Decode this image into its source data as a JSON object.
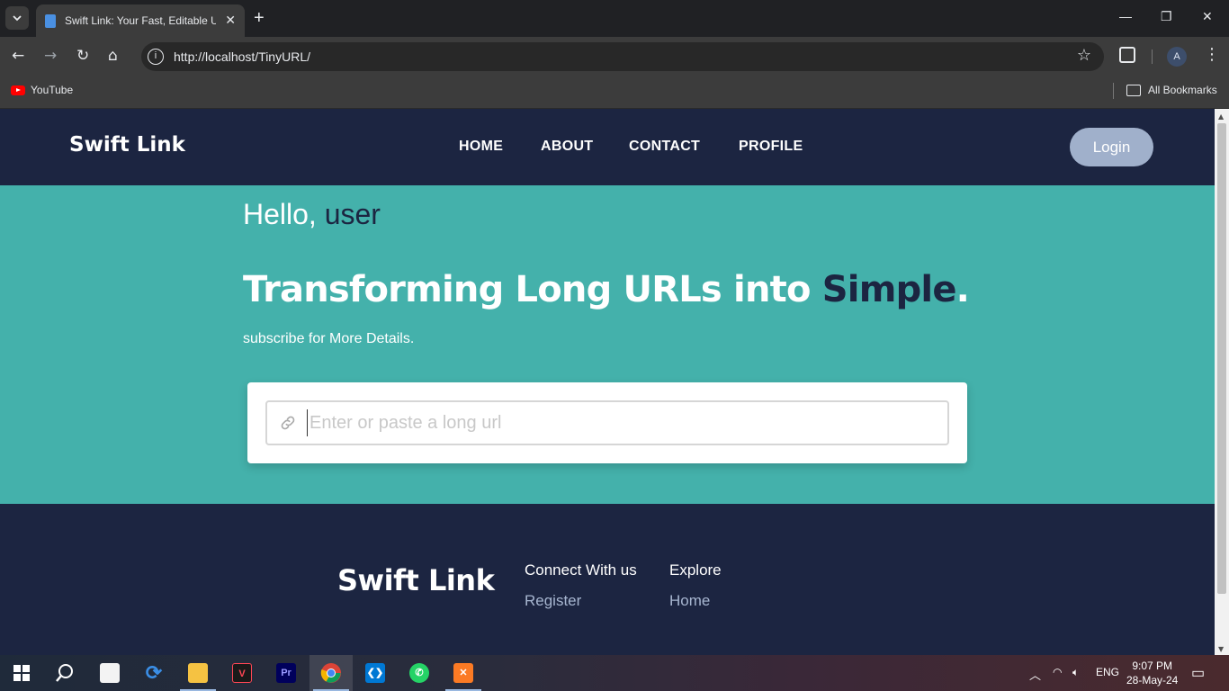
{
  "browser": {
    "tab_title": "Swift Link: Your Fast, Editable UI",
    "tab_close": "✕",
    "new_tab": "+",
    "url": "http://localhost/TinyURL/",
    "bookmarks": [
      {
        "label": "YouTube"
      }
    ],
    "all_bookmarks": "All Bookmarks",
    "profile_initial": "A",
    "minimize": "—",
    "restore": "❐",
    "close": "✕"
  },
  "header": {
    "brand": "Swift Link",
    "nav": [
      "HOME",
      "ABOUT",
      "CONTACT",
      "PROFILE"
    ],
    "login": "Login"
  },
  "hero": {
    "greeting": "Hello,",
    "username": "user",
    "headline": "Transforming Long URLs into",
    "headline_accent": "Simple",
    "headline_end": ".",
    "subtext": "subscribe for More Details.",
    "input_placeholder": "Enter or paste a long url"
  },
  "footer": {
    "brand": "Swift Link",
    "connect_heading": "Connect With us",
    "connect_link": "Register",
    "explore_heading": "Explore",
    "explore_link": "Home"
  },
  "taskbar": {
    "apps": [
      "start",
      "search",
      "store",
      "sync",
      "file-explorer",
      "valorant",
      "premiere-pro",
      "chrome",
      "vscode",
      "whatsapp",
      "xampp"
    ],
    "language": "ENG",
    "time": "9:07 PM",
    "date": "28-May-24"
  },
  "colors": {
    "navy": "#1c2541",
    "teal": "#44b1ab",
    "login_bg": "#a0b0cb",
    "footer_link": "#a7b6d0"
  }
}
